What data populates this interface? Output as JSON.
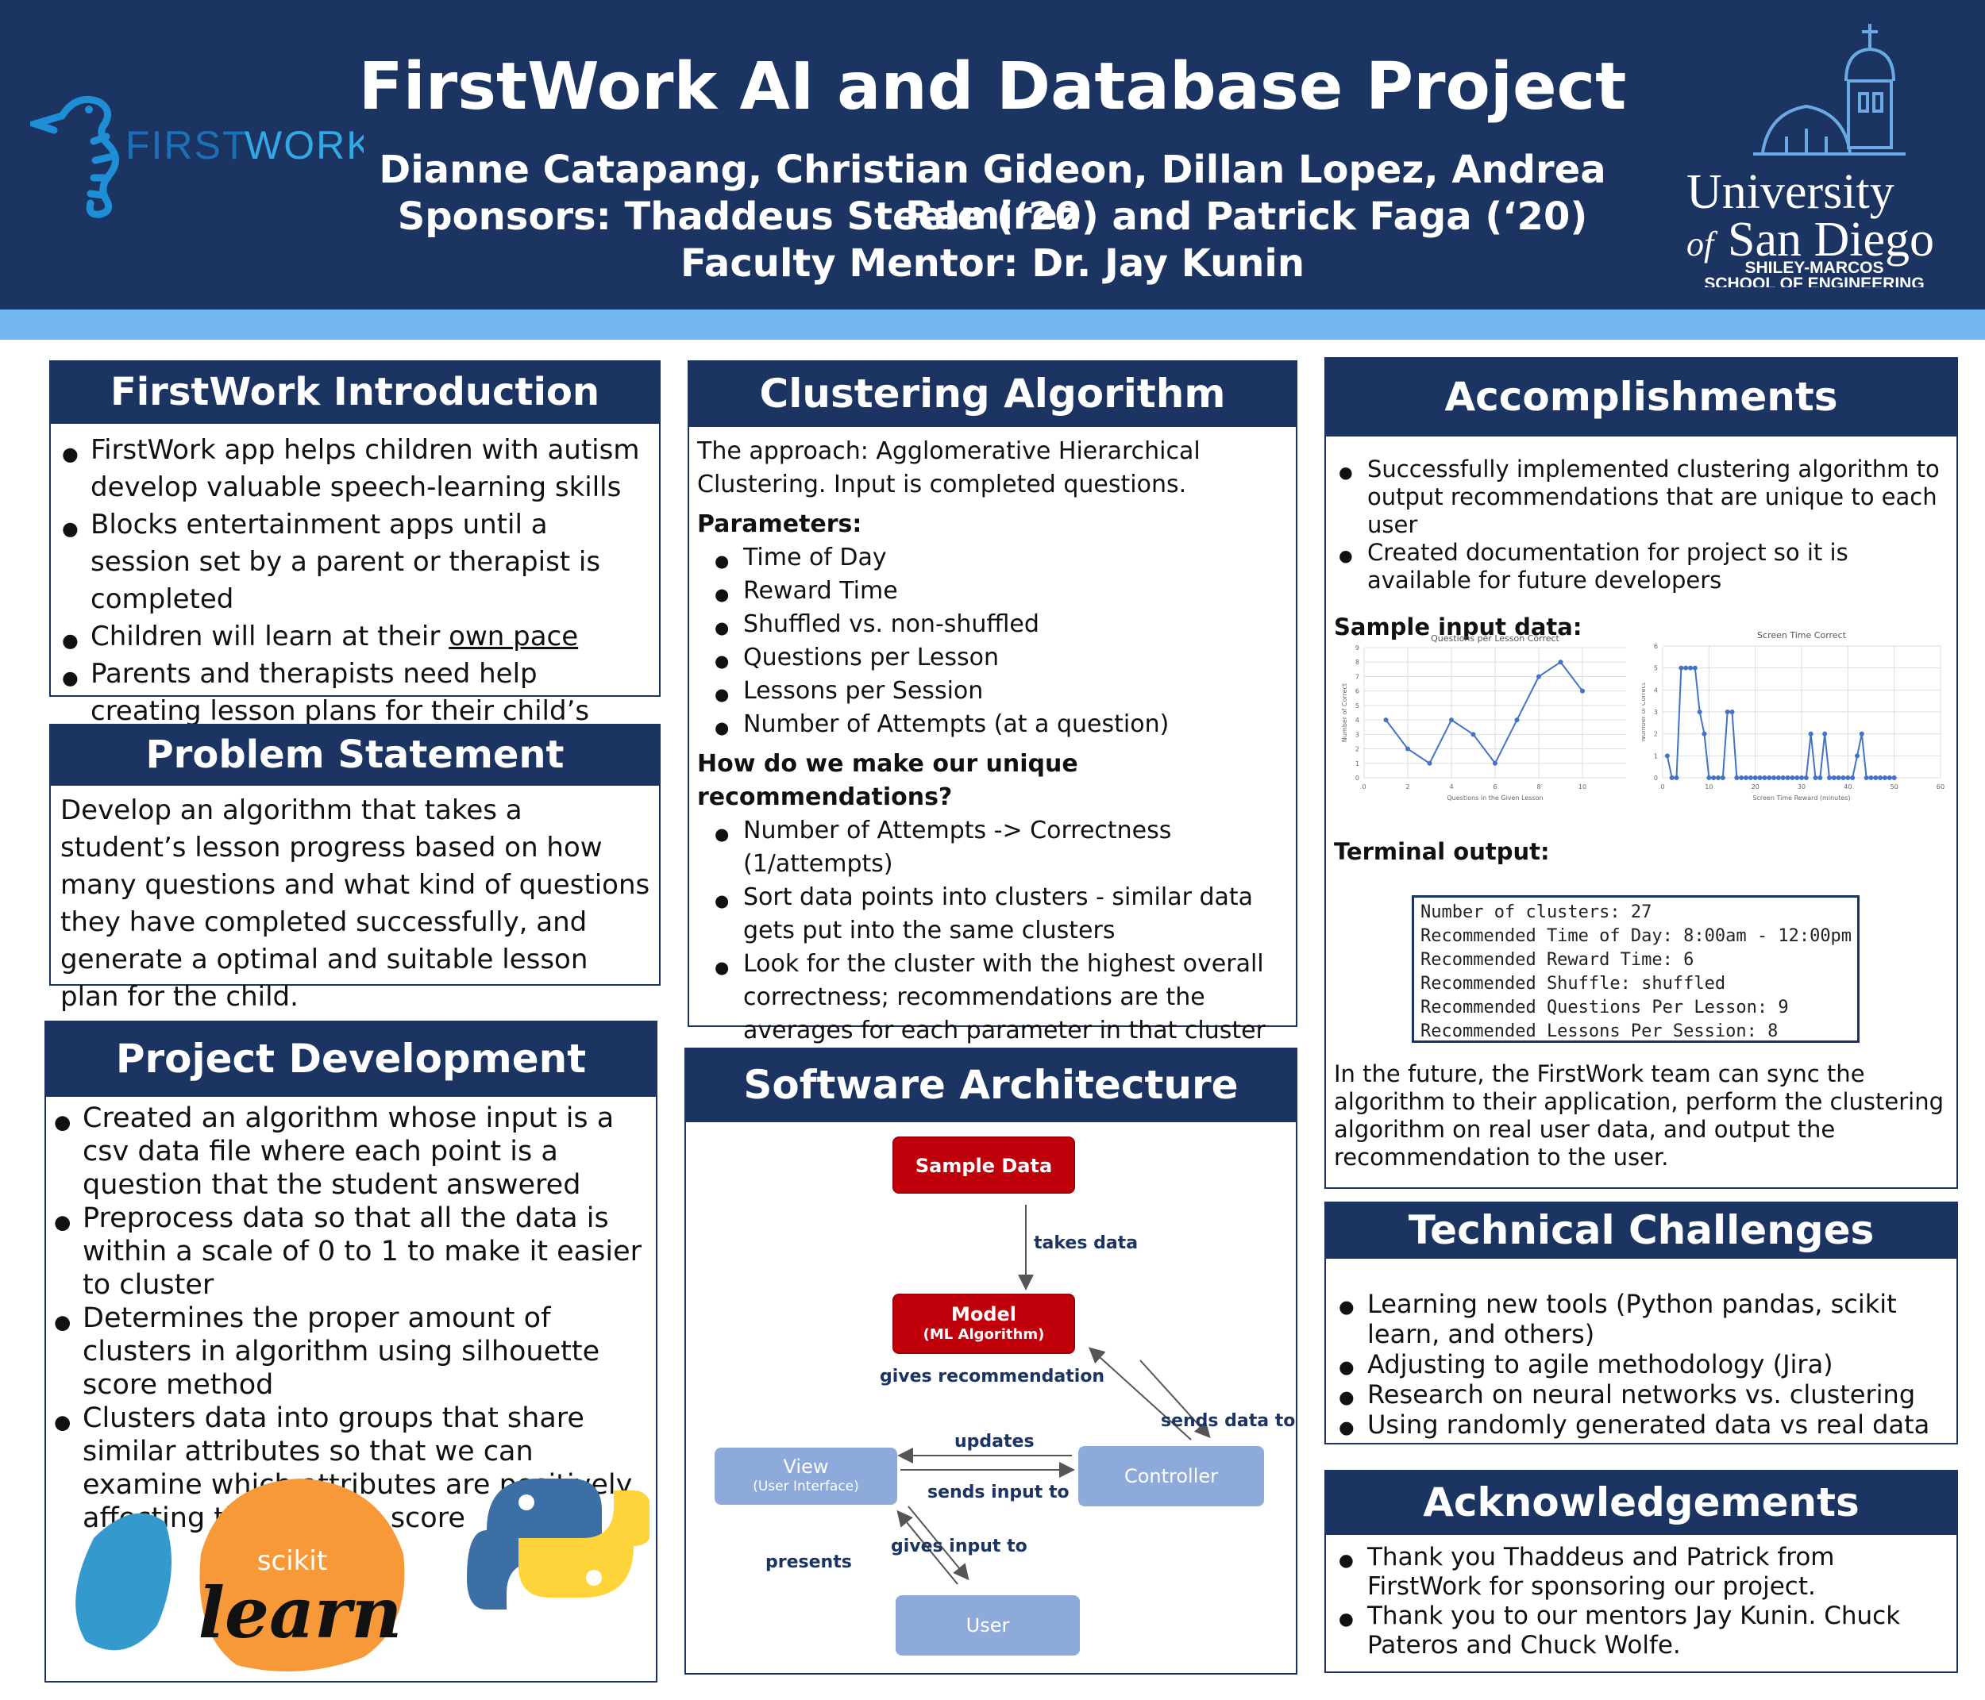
{
  "header": {
    "title": "FirstWork AI and Database Project",
    "authors": "Dianne Catapang, Christian Gideon, Dillan Lopez, Andrea Ramirez",
    "sponsors": "Sponsors: Thaddeus Steele (‘20) and Patrick Faga (‘20)",
    "mentor": "Faculty Mentor: Dr. Jay Kunin",
    "logo_left": {
      "first": "FIRST",
      "second": "WORK"
    },
    "logo_right": {
      "line1": "University",
      "line2a": "of",
      "line2b": "San Diego",
      "line3": "SHILEY-MARCOS",
      "line4": "SCHOOL OF ENGINEERING"
    }
  },
  "intro": {
    "heading": "FirstWork Introduction",
    "bullets": [
      {
        "pre": "FirstWork app helps children with autism develop valuable speech-learning skills",
        "u": "",
        "post": ""
      },
      {
        "pre": "Blocks entertainment apps until a session set by a parent or therapist is completed",
        "u": "",
        "post": ""
      },
      {
        "pre": "Children will learn at their ",
        "u": "own pace",
        "post": ""
      },
      {
        "pre": "Parents and therapists need help creating lesson plans for their child’s learning needs",
        "u": "",
        "post": ""
      }
    ]
  },
  "problem": {
    "heading": "Problem Statement",
    "text": "Develop an algorithm that takes a student’s lesson progress based on how many questions and what kind of questions they have completed successfully, and generate a optimal and suitable lesson plan for the child."
  },
  "development": {
    "heading": "Project Development",
    "bullets": [
      "Created an algorithm whose input is a csv data file where each point is a question that the student answered",
      "Preprocess data so that all the data is within a scale of 0 to 1 to make it easier to cluster",
      "Determines the proper amount of clusters in algorithm using silhouette score method",
      "Clusters data into groups that share similar attributes so that we can examine which attributes are positively affecting the learners score"
    ],
    "sklearn_top": "scikit",
    "sklearn_bottom": "learn"
  },
  "clustering": {
    "heading": "Clustering Algorithm",
    "approach": "The approach: Agglomerative Hierarchical Clustering. Input is completed questions.",
    "params_title": "Parameters:",
    "params": [
      "Time of Day",
      "Reward Time",
      "Shuffled vs. non-shuffled",
      "Questions per Lesson",
      "Lessons per Session",
      "Number of Attempts (at a question)"
    ],
    "how_title": "How do we make our unique recommendations?",
    "how": [
      "Number of Attempts -> Correctness (1/attempts)",
      "Sort data points into clusters - similar data gets put into the same clusters",
      "Look for the cluster with the highest overall correctness; recommendations are the averages for each parameter in that cluster"
    ]
  },
  "architecture": {
    "heading": "Software Architecture",
    "nodes": {
      "sample": "Sample Data",
      "model": "Model",
      "model_sub": "(ML Algorithm)",
      "view": "View",
      "view_sub": "(User Interface)",
      "controller": "Controller",
      "user": "User"
    },
    "edges": {
      "takes": "takes data",
      "gives_rec": "gives recommendation",
      "sends_data": "sends data to",
      "updates": "updates",
      "sends_input": "sends input to",
      "gives_input": "gives input to",
      "presents": "presents"
    },
    "colors": {
      "red": "#c0000b",
      "blue": "#8eaadb"
    }
  },
  "accomplishments": {
    "heading": "Accomplishments",
    "bullets": [
      "Successfully implemented clustering algorithm to output recommendations that are unique to each user",
      "Created documentation for project so it is available for future developers"
    ],
    "sample_title": "Sample input data:",
    "terminal_title": "Terminal output:",
    "terminal_lines": [
      "Number of clusters: 27",
      "Recommended Time of Day: 8:00am - 12:00pm",
      "Recommended Reward Time: 6",
      "Recommended Shuffle: shuffled",
      "Recommended Questions Per Lesson: 9",
      "Recommended Lessons Per Session: 8"
    ],
    "future": "In the future, the FirstWork team can sync the algorithm to their application, perform the clustering algorithm on real user data, and output the recommendation to the user."
  },
  "challenges": {
    "heading": "Technical Challenges",
    "bullets": [
      "Learning new tools (Python pandas, scikit learn, and others)",
      "Adjusting to agile methodology (Jira)",
      "Research on neural networks vs. clustering",
      "Using randomly generated data vs real data"
    ]
  },
  "acknowledgements": {
    "heading": "Acknowledgements",
    "bullets": [
      "Thank you Thaddeus and Patrick from FirstWork for sponsoring our project.",
      "Thank you to our mentors Jay Kunin. Chuck Pateros and Chuck Wolfe."
    ]
  },
  "chart_data": [
    {
      "type": "line",
      "title": "Questions per Lesson Correct",
      "xlabel": "Questions in the Given Lesson",
      "ylabel": "Number of Correct",
      "xlim": [
        0,
        12
      ],
      "ylim": [
        0,
        9
      ],
      "xticks": [
        0,
        2,
        4,
        6,
        8,
        10
      ],
      "yticks": [
        0,
        1,
        2,
        3,
        4,
        5,
        6,
        7,
        8,
        9
      ],
      "x": [
        1,
        2,
        3,
        4,
        5,
        6,
        7,
        8,
        9,
        10
      ],
      "y": [
        4,
        2,
        1,
        4,
        3,
        1,
        4,
        7,
        8,
        6
      ],
      "grid": true
    },
    {
      "type": "line",
      "title": "Screen Time Correct",
      "xlabel": "Screen Time Reward (minutes)",
      "ylabel": "Number of Correct",
      "xlim": [
        0,
        60
      ],
      "ylim": [
        0,
        6
      ],
      "xticks": [
        0,
        10,
        20,
        30,
        40,
        50,
        60
      ],
      "yticks": [
        0,
        1,
        2,
        3,
        4,
        5,
        6
      ],
      "x": [
        1,
        2,
        3,
        4,
        5,
        6,
        7,
        8,
        9,
        10,
        11,
        12,
        13,
        14,
        15,
        16,
        17,
        18,
        19,
        20,
        21,
        22,
        23,
        24,
        25,
        26,
        27,
        28,
        29,
        30,
        31,
        32,
        33,
        34,
        35,
        36,
        37,
        38,
        39,
        40,
        41,
        42,
        43,
        44,
        45,
        46,
        47,
        48,
        49,
        50
      ],
      "y": [
        1,
        0,
        0,
        5,
        5,
        5,
        5,
        3,
        2,
        0,
        0,
        0,
        0,
        3,
        3,
        0,
        0,
        0,
        0,
        0,
        0,
        0,
        0,
        0,
        0,
        0,
        0,
        0,
        0,
        0,
        0,
        2,
        0,
        0,
        2,
        0,
        0,
        0,
        0,
        0,
        0,
        1,
        2,
        0,
        0,
        0,
        0,
        0,
        0,
        0
      ],
      "grid": true
    }
  ]
}
